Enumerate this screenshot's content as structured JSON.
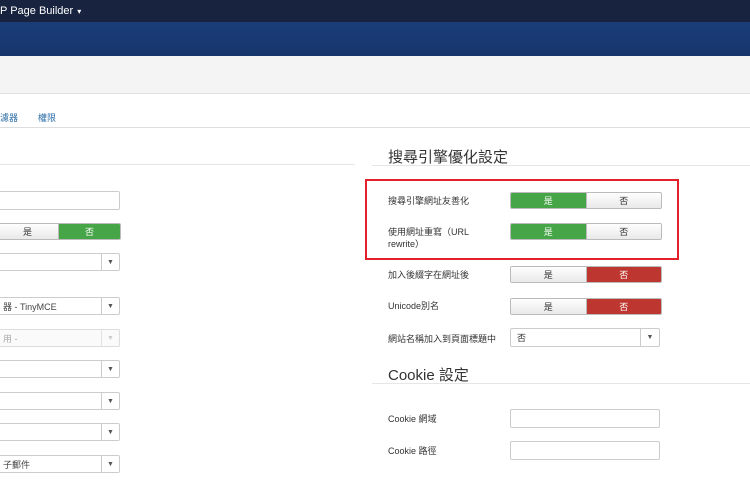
{
  "topbar": {
    "title": "P Page Builder",
    "caret": "▾"
  },
  "tabs": [
    {
      "label": "濾器"
    },
    {
      "label": "權限"
    }
  ],
  "left": {
    "toggle": {
      "yes": "是",
      "no": "否"
    },
    "fields": [
      {
        "value": ""
      },
      {
        "value": ""
      },
      {
        "value": "器 - TinyMCE"
      },
      {
        "value": "用 -"
      },
      {
        "value": ""
      },
      {
        "value": ""
      },
      {
        "value": ""
      },
      {
        "value": "子郵件"
      }
    ],
    "arrow": "▼"
  },
  "seo": {
    "title": "搜尋引擎優化設定",
    "rows": [
      {
        "label": "搜尋引擎網址友善化",
        "yes": "是",
        "no": "否",
        "selected": "yes"
      },
      {
        "label": "使用網址重寫（URL rewrite）",
        "yes": "是",
        "no": "否",
        "selected": "yes"
      },
      {
        "label": "加入後綴字在網址後",
        "yes": "是",
        "no": "否",
        "selected": "no"
      },
      {
        "label": "Unicode別名",
        "yes": "是",
        "no": "否",
        "selected": "no"
      }
    ],
    "sitename_label": "網站名稱加入到頁面標題中",
    "sitename_value": "否"
  },
  "cookie": {
    "title": "Cookie 設定",
    "domain_label": "Cookie 網域",
    "path_label": "Cookie 路徑"
  },
  "colors": {
    "topbar": "#17233f",
    "brand": "#1b3d78",
    "yes_on": "#46a546",
    "no_on": "#bd362f",
    "highlight": "#e3212a"
  }
}
